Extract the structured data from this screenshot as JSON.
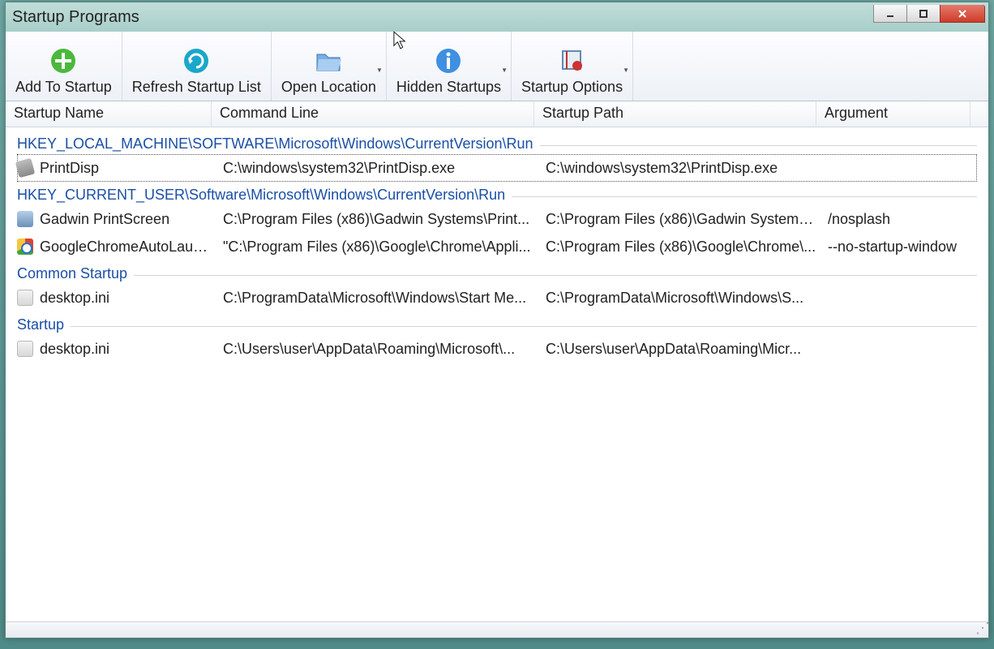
{
  "window": {
    "title": "Startup Programs"
  },
  "toolbar": {
    "add": {
      "label": "Add To Startup"
    },
    "refresh": {
      "label": "Refresh Startup List"
    },
    "open": {
      "label": "Open Location"
    },
    "hidden": {
      "label": "Hidden Startups"
    },
    "options": {
      "label": "Startup Options"
    }
  },
  "columns": {
    "name": "Startup Name",
    "cmd": "Command Line",
    "path": "Startup Path",
    "arg": "Argument"
  },
  "groups": [
    {
      "label": "HKEY_LOCAL_MACHINE\\SOFTWARE\\Microsoft\\Windows\\CurrentVersion\\Run",
      "items": [
        {
          "icon": "print",
          "name": "PrintDisp",
          "cmd": "C:\\windows\\system32\\PrintDisp.exe",
          "path": "C:\\windows\\system32\\PrintDisp.exe",
          "arg": "",
          "selected": true
        }
      ]
    },
    {
      "label": "HKEY_CURRENT_USER\\Software\\Microsoft\\Windows\\CurrentVersion\\Run",
      "items": [
        {
          "icon": "gadwin",
          "name": "Gadwin PrintScreen",
          "cmd": "C:\\Program Files (x86)\\Gadwin Systems\\Print...",
          "path": "C:\\Program Files (x86)\\Gadwin Systems\\...",
          "arg": "/nosplash"
        },
        {
          "icon": "chrome",
          "name": "GoogleChromeAutoLaun...",
          "cmd": "\"C:\\Program Files (x86)\\Google\\Chrome\\Appli...",
          "path": "C:\\Program Files (x86)\\Google\\Chrome\\...",
          "arg": "--no-startup-window"
        }
      ]
    },
    {
      "label": "Common Startup",
      "items": [
        {
          "icon": "ini",
          "name": "desktop.ini",
          "cmd": "C:\\ProgramData\\Microsoft\\Windows\\Start Me...",
          "path": "C:\\ProgramData\\Microsoft\\Windows\\S...",
          "arg": ""
        }
      ]
    },
    {
      "label": "Startup",
      "items": [
        {
          "icon": "ini",
          "name": "desktop.ini",
          "cmd": "C:\\Users\\user\\AppData\\Roaming\\Microsoft\\...",
          "path": "C:\\Users\\user\\AppData\\Roaming\\Micr...",
          "arg": ""
        }
      ]
    }
  ]
}
